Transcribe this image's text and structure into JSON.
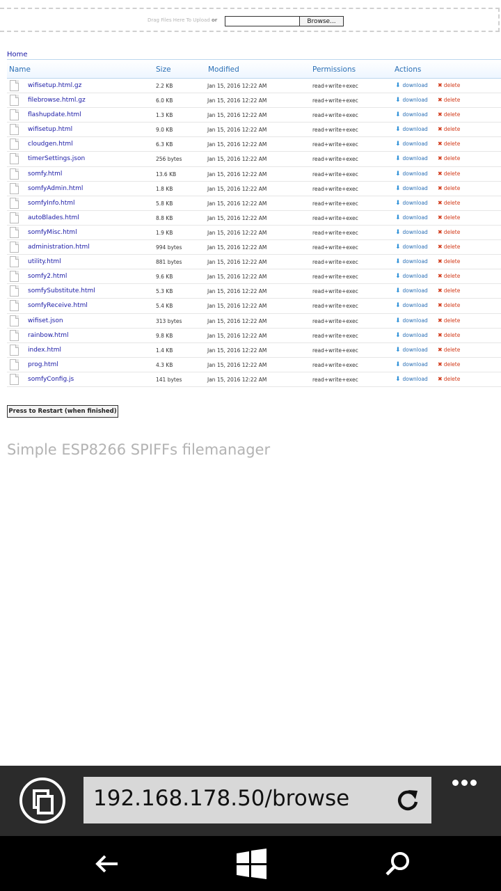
{
  "upload": {
    "drop_text": "Drag Files Here To Upload",
    "or_text": "or",
    "browse_label": "Browse..."
  },
  "breadcrumb": "Home",
  "table": {
    "headers": [
      "Name",
      "Size",
      "Modified",
      "Permissions",
      "Actions"
    ],
    "download_label": "download",
    "delete_label": "delete",
    "rows": [
      {
        "name": "wifisetup.html.gz",
        "size": "2.2 KB",
        "modified": "Jan 15, 2016 12:22 AM",
        "perm": "read+write+exec"
      },
      {
        "name": "filebrowse.html.gz",
        "size": "6.0 KB",
        "modified": "Jan 15, 2016 12:22 AM",
        "perm": "read+write+exec"
      },
      {
        "name": "flashupdate.html",
        "size": "1.3 KB",
        "modified": "Jan 15, 2016 12:22 AM",
        "perm": "read+write+exec"
      },
      {
        "name": "wifisetup.html",
        "size": "9.0 KB",
        "modified": "Jan 15, 2016 12:22 AM",
        "perm": "read+write+exec"
      },
      {
        "name": "cloudgen.html",
        "size": "6.3 KB",
        "modified": "Jan 15, 2016 12:22 AM",
        "perm": "read+write+exec"
      },
      {
        "name": "timerSettings.json",
        "size": "256 bytes",
        "modified": "Jan 15, 2016 12:22 AM",
        "perm": "read+write+exec"
      },
      {
        "name": "somfy.html",
        "size": "13.6 KB",
        "modified": "Jan 15, 2016 12:22 AM",
        "perm": "read+write+exec"
      },
      {
        "name": "somfyAdmin.html",
        "size": "1.8 KB",
        "modified": "Jan 15, 2016 12:22 AM",
        "perm": "read+write+exec"
      },
      {
        "name": "somfyInfo.html",
        "size": "5.8 KB",
        "modified": "Jan 15, 2016 12:22 AM",
        "perm": "read+write+exec"
      },
      {
        "name": "autoBlades.html",
        "size": "8.8 KB",
        "modified": "Jan 15, 2016 12:22 AM",
        "perm": "read+write+exec"
      },
      {
        "name": "somfyMisc.html",
        "size": "1.9 KB",
        "modified": "Jan 15, 2016 12:22 AM",
        "perm": "read+write+exec"
      },
      {
        "name": "administration.html",
        "size": "994 bytes",
        "modified": "Jan 15, 2016 12:22 AM",
        "perm": "read+write+exec"
      },
      {
        "name": "utility.html",
        "size": "881 bytes",
        "modified": "Jan 15, 2016 12:22 AM",
        "perm": "read+write+exec"
      },
      {
        "name": "somfy2.html",
        "size": "9.6 KB",
        "modified": "Jan 15, 2016 12:22 AM",
        "perm": "read+write+exec"
      },
      {
        "name": "somfySubstitute.html",
        "size": "5.3 KB",
        "modified": "Jan 15, 2016 12:22 AM",
        "perm": "read+write+exec"
      },
      {
        "name": "somfyReceive.html",
        "size": "5.4 KB",
        "modified": "Jan 15, 2016 12:22 AM",
        "perm": "read+write+exec"
      },
      {
        "name": "wifiset.json",
        "size": "313 bytes",
        "modified": "Jan 15, 2016 12:22 AM",
        "perm": "read+write+exec"
      },
      {
        "name": "rainbow.html",
        "size": "9.8 KB",
        "modified": "Jan 15, 2016 12:22 AM",
        "perm": "read+write+exec"
      },
      {
        "name": "index.html",
        "size": "1.4 KB",
        "modified": "Jan 15, 2016 12:22 AM",
        "perm": "read+write+exec"
      },
      {
        "name": "prog.html",
        "size": "4.3 KB",
        "modified": "Jan 15, 2016 12:22 AM",
        "perm": "read+write+exec"
      },
      {
        "name": "somfyConfig.js",
        "size": "141 bytes",
        "modified": "Jan 15, 2016 12:22 AM",
        "perm": "read+write+exec"
      }
    ]
  },
  "restart_label": "Press to Restart (when finished)",
  "footer_title": "Simple ESP8266 SPIFFs filemanager",
  "browser": {
    "url": "192.168.178.50/browse"
  },
  "icons": {
    "row_icon": "document-icon",
    "download_icon": "download-arrow-icon",
    "delete_icon": "delete-x-icon",
    "tabs_icon": "tabs-icon",
    "refresh_icon": "refresh-icon",
    "more_icon": "more-dots-icon",
    "back_icon": "back-arrow-icon",
    "windows_icon": "windows-logo-icon",
    "search_icon": "search-icon"
  },
  "colors": {
    "link": "#1a1aa6",
    "header_text": "#2a6fb5",
    "delete": "#d23a1a",
    "browser_bar": "#2b2b2b",
    "nav_bar": "#000000"
  }
}
